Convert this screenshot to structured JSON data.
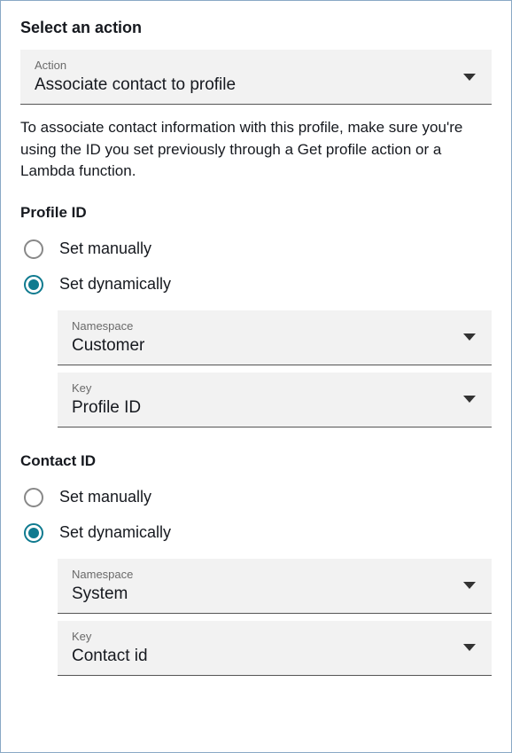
{
  "header": {
    "title": "Select an action"
  },
  "action_dropdown": {
    "label": "Action",
    "value": "Associate contact to profile"
  },
  "help_text": "To associate contact information with this profile, make sure you're using the ID you set previously through a Get profile action or a Lambda function.",
  "profile_id": {
    "title": "Profile ID",
    "radio_manual": "Set manually",
    "radio_dynamic": "Set dynamically",
    "namespace": {
      "label": "Namespace",
      "value": "Customer"
    },
    "key": {
      "label": "Key",
      "value": "Profile ID"
    }
  },
  "contact_id": {
    "title": "Contact ID",
    "radio_manual": "Set manually",
    "radio_dynamic": "Set dynamically",
    "namespace": {
      "label": "Namespace",
      "value": "System"
    },
    "key": {
      "label": "Key",
      "value": "Contact id"
    }
  }
}
